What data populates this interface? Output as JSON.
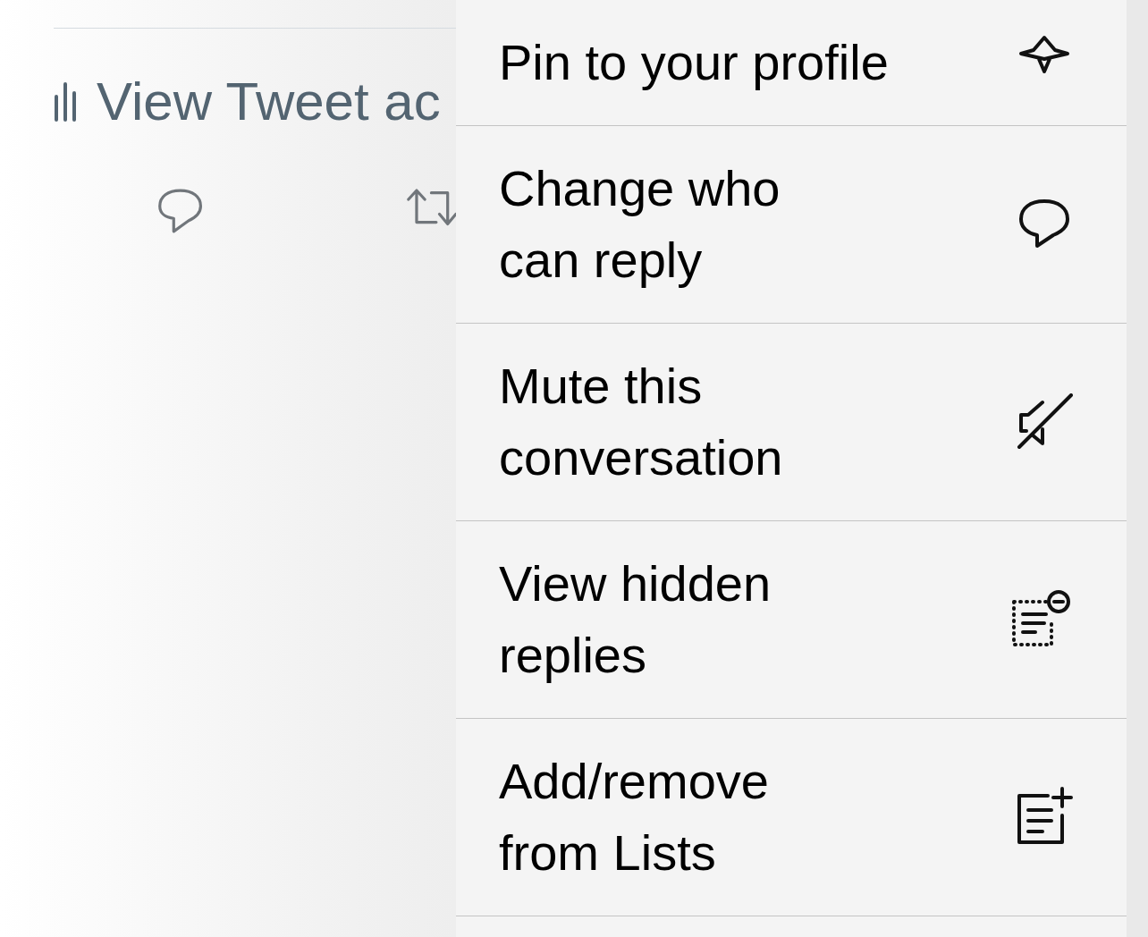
{
  "tweet": {
    "analytics_link": "View Tweet ac"
  },
  "menu": {
    "items": [
      {
        "lines": [
          "Pin to your profile"
        ],
        "kind": "pin"
      },
      {
        "lines": [
          "Change who",
          "can reply"
        ],
        "kind": "reply"
      },
      {
        "lines": [
          "Mute this",
          "conversation"
        ],
        "kind": "mute"
      },
      {
        "lines": [
          "View hidden",
          "replies"
        ],
        "kind": "hidden"
      },
      {
        "lines": [
          "Add/remove",
          "from Lists"
        ],
        "kind": "lists"
      }
    ]
  }
}
